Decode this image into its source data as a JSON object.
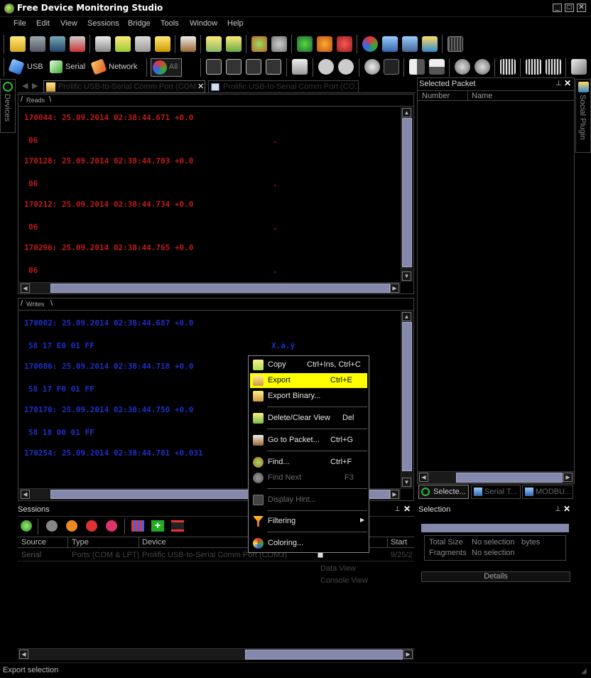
{
  "title": "Free Device Monitoring Studio",
  "menu": [
    "File",
    "Edit",
    "View",
    "Sessions",
    "Bridge",
    "Tools",
    "Window",
    "Help"
  ],
  "toolbar2": {
    "usb": "USB",
    "serial": "Serial",
    "network": "Network",
    "all": "All"
  },
  "left_dock": {
    "devices_label": "Devices"
  },
  "right_dock": {
    "social_label": "Social Plugin"
  },
  "doc_tabs": [
    "Prolific USB-to-Serial Comm Port (COM...",
    "Prolific USB-to-Serial Comm Port (CO..."
  ],
  "reads": {
    "tab": "Reads",
    "entries": [
      {
        "header": "170044: 25.09.2014 02:38:44.671 +0.0",
        "hex": "06",
        "ascii": "."
      },
      {
        "header": "170128: 25.09.2014 02:38:44.703 +0.0",
        "hex": "06",
        "ascii": "."
      },
      {
        "header": "170212: 25.09.2014 02:38:44.734 +0.0",
        "hex": "06",
        "ascii": "."
      },
      {
        "header": "170296: 25.09.2014 02:38:44.765 +0.0",
        "hex": "06",
        "ascii": "."
      }
    ]
  },
  "writes": {
    "tab": "Writes",
    "entries": [
      {
        "header": "170002: 25.09.2014 02:38:44.687 +0.0",
        "hex": "58 17 E0 01 FF",
        "ascii": "X.à.ÿ"
      },
      {
        "header": "170086: 25.09.2014 02:38:44.718 +0.0",
        "hex": "58 17 F0 01 FF",
        "ascii": ""
      },
      {
        "header": "170170: 25.09.2014 02:38:44.750 +0.0",
        "hex": "58 18 00 01 FF",
        "ascii": ""
      },
      {
        "header": "170254: 25.09.2014 02:38:44.781 +0.031",
        "hex": "",
        "ascii": ""
      }
    ]
  },
  "selected_packet": {
    "title": "Selected Packet",
    "cols": [
      "Number",
      "Name"
    ]
  },
  "bottom_tabs": [
    "Selecte...",
    "Serial T...",
    "MODBU..."
  ],
  "sessions": {
    "title": "Sessions",
    "cols": [
      "Source",
      "Type",
      "Device",
      "Start"
    ],
    "row": {
      "source": "Serial",
      "type": "Ports (COM & LPT)",
      "device": "Prolific USB-to-Serial Comm Port (COM3)",
      "start": "9/25/2"
    },
    "subitems": [
      "Data View",
      "Console View"
    ]
  },
  "selection": {
    "title": "Selection",
    "total_size_label": "Total Size",
    "total_size_val": "No selection",
    "bytes": "bytes",
    "fragments_label": "Fragments",
    "fragments_val": "No selection",
    "details": "Details"
  },
  "context_menu": [
    {
      "label": "Copy",
      "shortcut": "Ctrl+Ins, Ctrl+C",
      "state": "normal"
    },
    {
      "label": "Export",
      "shortcut": "Ctrl+E",
      "state": "highlight"
    },
    {
      "label": "Export Binary...",
      "shortcut": "",
      "state": "normal"
    },
    {
      "label": "Delete/Clear View",
      "shortcut": "Del",
      "state": "normal"
    },
    {
      "label": "Go to Packet...",
      "shortcut": "Ctrl+G",
      "state": "normal"
    },
    {
      "label": "Find...",
      "shortcut": "Ctrl+F",
      "state": "normal"
    },
    {
      "label": "Find Next",
      "shortcut": "F3",
      "state": "disabled"
    },
    {
      "label": "Display Hint...",
      "shortcut": "",
      "state": "disabled"
    },
    {
      "label": "Filtering",
      "shortcut": "",
      "state": "submenu"
    },
    {
      "label": "Coloring...",
      "shortcut": "",
      "state": "normal"
    }
  ],
  "status": "Export selection",
  "colors": {
    "accent": "#ffff00",
    "read": "#c01a1a",
    "write": "#1c2fc8",
    "scroll": "#8488ad"
  }
}
